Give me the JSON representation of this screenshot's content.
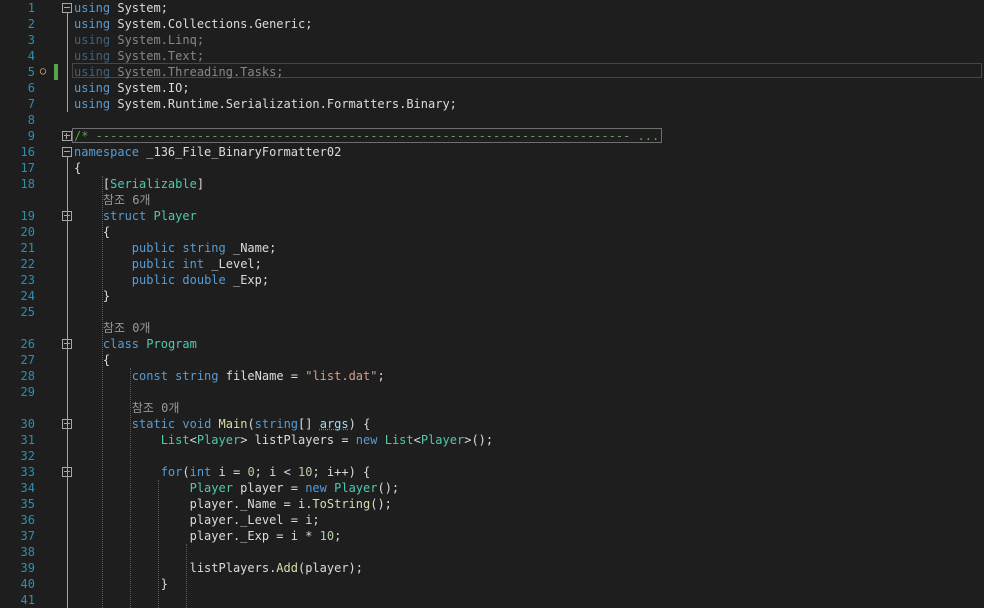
{
  "editor": {
    "lines": [
      {
        "n": "1",
        "t": "using System;"
      },
      {
        "n": "2",
        "t": "using System.Collections.Generic;"
      },
      {
        "n": "3",
        "t": "using System.Linq;"
      },
      {
        "n": "4",
        "t": "using System.Text;"
      },
      {
        "n": "5",
        "t": "using System.Threading.Tasks;"
      },
      {
        "n": "6",
        "t": "using System.IO;"
      },
      {
        "n": "7",
        "t": "using System.Runtime.Serialization.Formatters.Binary;"
      },
      {
        "n": "8",
        "t": ""
      },
      {
        "n": "9",
        "t": "/* -------------------------------------------------------------------------- ..."
      },
      {
        "n": "16",
        "t": "namespace _136_File_BinaryFormatter02"
      },
      {
        "n": "17",
        "t": "{"
      },
      {
        "n": "18",
        "t": "    [Serializable]"
      },
      {
        "n": "",
        "t": "    참조 6개"
      },
      {
        "n": "19",
        "t": "    struct Player"
      },
      {
        "n": "20",
        "t": "    {"
      },
      {
        "n": "21",
        "t": "        public string _Name;"
      },
      {
        "n": "22",
        "t": "        public int _Level;"
      },
      {
        "n": "23",
        "t": "        public double _Exp;"
      },
      {
        "n": "24",
        "t": "    }"
      },
      {
        "n": "25",
        "t": ""
      },
      {
        "n": "",
        "t": "    참조 0개"
      },
      {
        "n": "26",
        "t": "    class Program"
      },
      {
        "n": "27",
        "t": "    {"
      },
      {
        "n": "28",
        "t": "        const string fileName = \"list.dat\";"
      },
      {
        "n": "29",
        "t": ""
      },
      {
        "n": "",
        "t": "        참조 0개"
      },
      {
        "n": "30",
        "t": "        static void Main(string[] args) {"
      },
      {
        "n": "31",
        "t": "            List<Player> listPlayers = new List<Player>();"
      },
      {
        "n": "32",
        "t": ""
      },
      {
        "n": "33",
        "t": "            for(int i = 0; i < 10; i++) {"
      },
      {
        "n": "34",
        "t": "                Player player = new Player();"
      },
      {
        "n": "35",
        "t": "                player._Name = i.ToString();"
      },
      {
        "n": "36",
        "t": "                player._Level = i;"
      },
      {
        "n": "37",
        "t": "                player._Exp = i * 10;"
      },
      {
        "n": "38",
        "t": ""
      },
      {
        "n": "39",
        "t": "                listPlayers.Add(player);"
      },
      {
        "n": "40",
        "t": "            }"
      },
      {
        "n": "41",
        "t": ""
      }
    ],
    "colors": {
      "background": "#1e1e1e",
      "keyword": "#569cd6",
      "type": "#4ec9b0",
      "string": "#d69d85",
      "comment": "#57a64a",
      "method": "#dcdcaa",
      "parameter": "#9cdcfe",
      "number": "#b5cea8",
      "line_number": "#2b91af",
      "codelens": "#999999"
    },
    "icons": [
      "lightbulb-icon",
      "collapse-icon",
      "expand-icon"
    ]
  }
}
